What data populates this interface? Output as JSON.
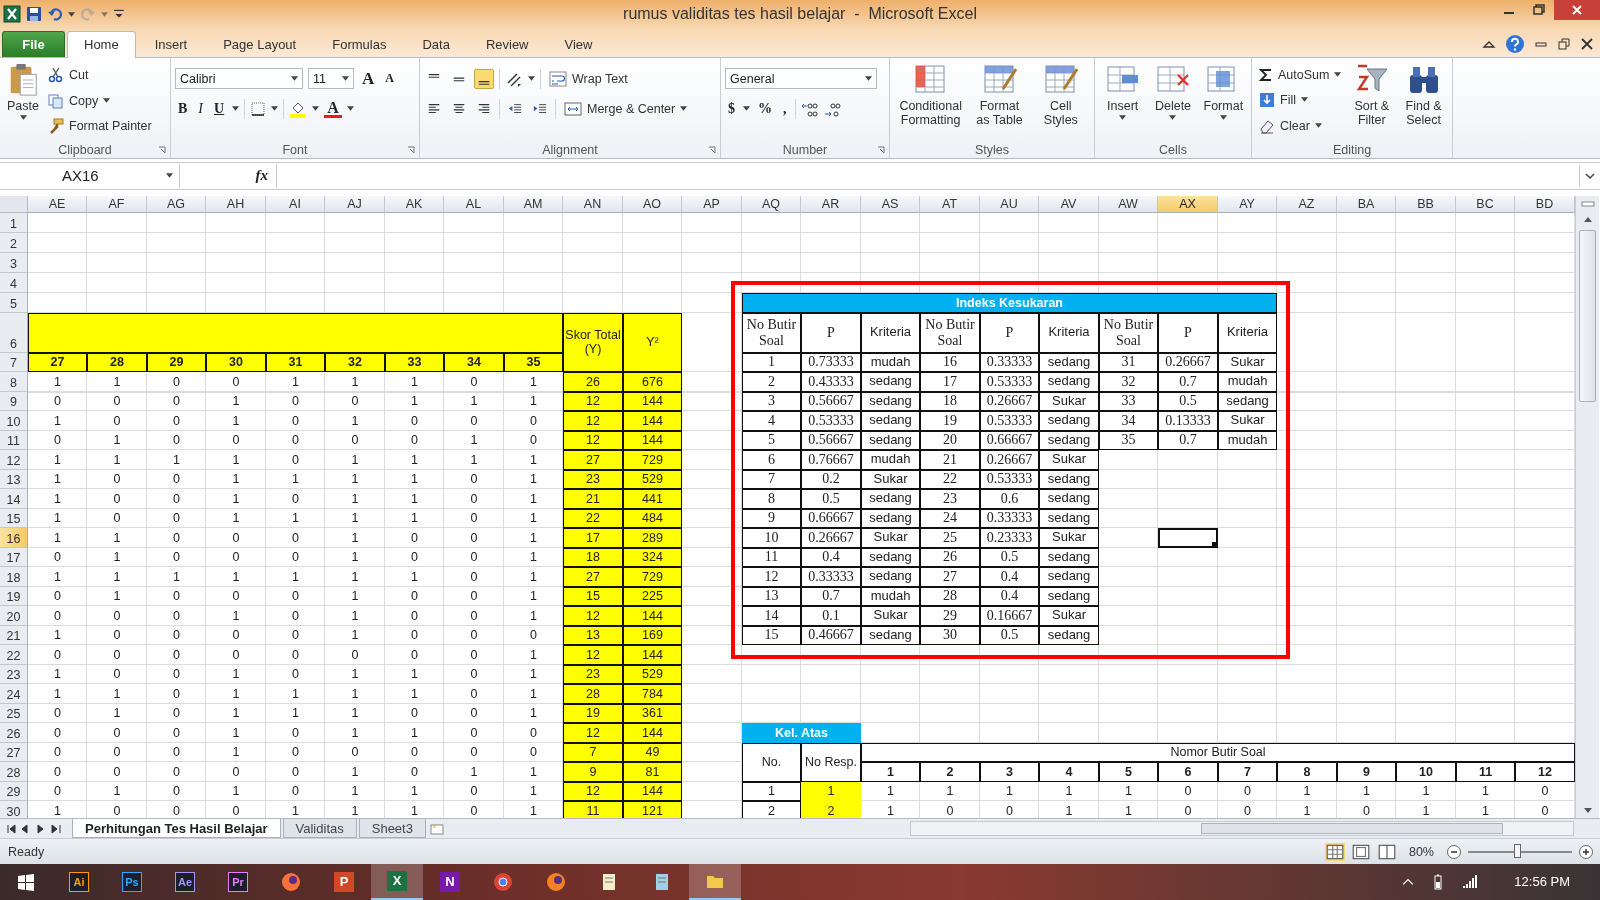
{
  "window": {
    "title": "rumus validitas tes hasil belajar  -  Microsoft Excel"
  },
  "ribbon_tabs": [
    {
      "label": "File",
      "kind": "file",
      "selected": false
    },
    {
      "label": "Home",
      "kind": "tab",
      "selected": true
    },
    {
      "label": "Insert",
      "kind": "tab",
      "selected": false
    },
    {
      "label": "Page Layout",
      "kind": "tab",
      "selected": false
    },
    {
      "label": "Formulas",
      "kind": "tab",
      "selected": false
    },
    {
      "label": "Data",
      "kind": "tab",
      "selected": false
    },
    {
      "label": "Review",
      "kind": "tab",
      "selected": false
    },
    {
      "label": "View",
      "kind": "tab",
      "selected": false
    }
  ],
  "ribbon": {
    "clipboard": {
      "label": "Clipboard",
      "paste": "Paste",
      "cut": "Cut",
      "copy": "Copy",
      "format_painter": "Format Painter"
    },
    "font": {
      "label": "Font",
      "font_name": "Calibri",
      "font_size": "11",
      "grow": "A",
      "shrink": "A",
      "bold": "B",
      "italic": "I",
      "underline": "U",
      "font_color": "A"
    },
    "alignment": {
      "label": "Alignment",
      "valign_buttons": [
        {
          "selected": false
        },
        {
          "selected": false
        },
        {
          "selected": true
        }
      ],
      "wrap_text": "Wrap Text",
      "merge_center": "Merge & Center"
    },
    "number": {
      "label": "Number",
      "format": "General",
      "currency": "$",
      "percent": "%",
      "comma": ","
    },
    "styles": {
      "label": "Styles",
      "buttons": [
        "Conditional Formatting",
        "Format as Table",
        "Cell Styles"
      ]
    },
    "cells": {
      "label": "Cells",
      "buttons": [
        "Insert",
        "Delete",
        "Format"
      ]
    },
    "editing": {
      "label": "Editing",
      "autosum": "AutoSum",
      "fill": "Fill",
      "clear": "Clear",
      "sort_filter": "Sort & Filter",
      "find_select": "Find & Select"
    }
  },
  "formula_bar": {
    "name_box": "AX16",
    "fx": "fx"
  },
  "sheet": {
    "columns": [
      {
        "label": "AE",
        "selected": false
      },
      {
        "label": "AF",
        "selected": false
      },
      {
        "label": "AG",
        "selected": false
      },
      {
        "label": "AH",
        "selected": false
      },
      {
        "label": "AI",
        "selected": false
      },
      {
        "label": "AJ",
        "selected": false
      },
      {
        "label": "AK",
        "selected": false
      },
      {
        "label": "AL",
        "selected": false
      },
      {
        "label": "AM",
        "selected": false
      },
      {
        "label": "AN",
        "selected": false
      },
      {
        "label": "AO",
        "selected": false
      },
      {
        "label": "AP",
        "selected": false
      },
      {
        "label": "AQ",
        "selected": false
      },
      {
        "label": "AR",
        "selected": false
      },
      {
        "label": "AS",
        "selected": false
      },
      {
        "label": "AT",
        "selected": false
      },
      {
        "label": "AU",
        "selected": false
      },
      {
        "label": "AV",
        "selected": false
      },
      {
        "label": "AW",
        "selected": false
      },
      {
        "label": "AX",
        "selected": true
      },
      {
        "label": "AY",
        "selected": false
      },
      {
        "label": "AZ",
        "selected": false
      },
      {
        "label": "BA",
        "selected": false
      },
      {
        "label": "BB",
        "selected": false
      },
      {
        "label": "BC",
        "selected": false
      },
      {
        "label": "BD",
        "selected": false
      }
    ],
    "rows": [
      {
        "label": "1",
        "selected": false
      },
      {
        "label": "2",
        "selected": false
      },
      {
        "label": "3",
        "selected": false
      },
      {
        "label": "4",
        "selected": false
      },
      {
        "label": "5",
        "selected": false
      },
      {
        "label": "6",
        "selected": false
      },
      {
        "label": "7",
        "selected": false
      },
      {
        "label": "8",
        "selected": false
      },
      {
        "label": "9",
        "selected": false
      },
      {
        "label": "10",
        "selected": false
      },
      {
        "label": "11",
        "selected": false
      },
      {
        "label": "12",
        "selected": false
      },
      {
        "label": "13",
        "selected": false
      },
      {
        "label": "14",
        "selected": false
      },
      {
        "label": "15",
        "selected": false
      },
      {
        "label": "16",
        "selected": true
      },
      {
        "label": "17",
        "selected": false
      },
      {
        "label": "18",
        "selected": false
      },
      {
        "label": "19",
        "selected": false
      },
      {
        "label": "20",
        "selected": false
      },
      {
        "label": "21",
        "selected": false
      },
      {
        "label": "22",
        "selected": false
      },
      {
        "label": "23",
        "selected": false
      },
      {
        "label": "24",
        "selected": false
      },
      {
        "label": "25",
        "selected": false
      },
      {
        "label": "26",
        "selected": false
      },
      {
        "label": "27",
        "selected": false
      },
      {
        "label": "28",
        "selected": false
      },
      {
        "label": "29",
        "selected": false
      },
      {
        "label": "30",
        "selected": false
      }
    ]
  },
  "score_table": {
    "item_numbers": [
      "27",
      "28",
      "29",
      "30",
      "31",
      "32",
      "33",
      "34",
      "35"
    ],
    "total_header": "Skor Total (Y)",
    "square_header": "Y²",
    "rows": [
      {
        "scores": [
          "1",
          "1",
          "0",
          "0",
          "1",
          "1",
          "1",
          "0",
          "1"
        ],
        "total": "26",
        "square": "676"
      },
      {
        "scores": [
          "0",
          "0",
          "0",
          "1",
          "0",
          "0",
          "1",
          "1",
          "1"
        ],
        "total": "12",
        "square": "144"
      },
      {
        "scores": [
          "1",
          "0",
          "0",
          "1",
          "0",
          "1",
          "0",
          "0",
          "0"
        ],
        "total": "12",
        "square": "144"
      },
      {
        "scores": [
          "0",
          "1",
          "0",
          "0",
          "0",
          "0",
          "0",
          "1",
          "0"
        ],
        "total": "12",
        "square": "144"
      },
      {
        "scores": [
          "1",
          "1",
          "1",
          "1",
          "0",
          "1",
          "1",
          "1",
          "1"
        ],
        "total": "27",
        "square": "729"
      },
      {
        "scores": [
          "1",
          "0",
          "0",
          "1",
          "1",
          "1",
          "1",
          "0",
          "1"
        ],
        "total": "23",
        "square": "529"
      },
      {
        "scores": [
          "1",
          "0",
          "0",
          "1",
          "0",
          "1",
          "1",
          "0",
          "1"
        ],
        "total": "21",
        "square": "441"
      },
      {
        "scores": [
          "1",
          "0",
          "0",
          "1",
          "1",
          "1",
          "1",
          "0",
          "1"
        ],
        "total": "22",
        "square": "484"
      },
      {
        "scores": [
          "1",
          "1",
          "0",
          "0",
          "0",
          "1",
          "0",
          "0",
          "1"
        ],
        "total": "17",
        "square": "289"
      },
      {
        "scores": [
          "0",
          "1",
          "0",
          "0",
          "0",
          "1",
          "0",
          "0",
          "1"
        ],
        "total": "18",
        "square": "324"
      },
      {
        "scores": [
          "1",
          "1",
          "1",
          "1",
          "1",
          "1",
          "1",
          "0",
          "1"
        ],
        "total": "27",
        "square": "729"
      },
      {
        "scores": [
          "0",
          "1",
          "0",
          "0",
          "0",
          "1",
          "0",
          "0",
          "1"
        ],
        "total": "15",
        "square": "225"
      },
      {
        "scores": [
          "0",
          "0",
          "0",
          "1",
          "0",
          "1",
          "0",
          "0",
          "1"
        ],
        "total": "12",
        "square": "144"
      },
      {
        "scores": [
          "1",
          "0",
          "0",
          "0",
          "0",
          "1",
          "0",
          "0",
          "0"
        ],
        "total": "13",
        "square": "169"
      },
      {
        "scores": [
          "0",
          "0",
          "0",
          "0",
          "0",
          "0",
          "0",
          "0",
          "1"
        ],
        "total": "12",
        "square": "144"
      },
      {
        "scores": [
          "1",
          "0",
          "0",
          "1",
          "0",
          "1",
          "1",
          "0",
          "1"
        ],
        "total": "23",
        "square": "529"
      },
      {
        "scores": [
          "1",
          "1",
          "0",
          "1",
          "1",
          "1",
          "1",
          "0",
          "1"
        ],
        "total": "28",
        "square": "784"
      },
      {
        "scores": [
          "0",
          "1",
          "0",
          "1",
          "1",
          "1",
          "0",
          "0",
          "1"
        ],
        "total": "19",
        "square": "361"
      },
      {
        "scores": [
          "0",
          "0",
          "0",
          "1",
          "0",
          "1",
          "1",
          "0",
          "0"
        ],
        "total": "12",
        "square": "144"
      },
      {
        "scores": [
          "0",
          "0",
          "0",
          "1",
          "0",
          "0",
          "0",
          "0",
          "0"
        ],
        "total": "7",
        "square": "49"
      },
      {
        "scores": [
          "0",
          "0",
          "0",
          "0",
          "0",
          "1",
          "0",
          "1",
          "1"
        ],
        "total": "9",
        "square": "81"
      },
      {
        "scores": [
          "0",
          "1",
          "0",
          "1",
          "0",
          "1",
          "1",
          "0",
          "1"
        ],
        "total": "12",
        "square": "144"
      },
      {
        "scores": [
          "1",
          "0",
          "0",
          "0",
          "1",
          "1",
          "1",
          "0",
          "1"
        ],
        "total": "11",
        "square": "121"
      }
    ]
  },
  "difficulty_table": {
    "title": "Indeks Kesukaran",
    "headers": [
      "No Butir Soal",
      "P",
      "Kriteria",
      "No Butir Soal",
      "P",
      "Kriteria",
      "No Butir Soal",
      "P",
      "Kriteria"
    ],
    "rows": [
      {
        "cells": [
          "1",
          "0.73333",
          "mudah",
          "16",
          "0.33333",
          "sedang",
          "31",
          "0.26667",
          "Sukar"
        ]
      },
      {
        "cells": [
          "2",
          "0.43333",
          "sedang",
          "17",
          "0.53333",
          "sedang",
          "32",
          "0.7",
          "mudah"
        ]
      },
      {
        "cells": [
          "3",
          "0.56667",
          "sedang",
          "18",
          "0.26667",
          "Sukar",
          "33",
          "0.5",
          "sedang"
        ]
      },
      {
        "cells": [
          "4",
          "0.53333",
          "sedang",
          "19",
          "0.53333",
          "sedang",
          "34",
          "0.13333",
          "Sukar"
        ]
      },
      {
        "cells": [
          "5",
          "0.56667",
          "sedang",
          "20",
          "0.66667",
          "sedang",
          "35",
          "0.7",
          "mudah"
        ]
      },
      {
        "cells": [
          "6",
          "0.76667",
          "mudah",
          "21",
          "0.26667",
          "Sukar"
        ]
      },
      {
        "cells": [
          "7",
          "0.2",
          "Sukar",
          "22",
          "0.53333",
          "sedang"
        ]
      },
      {
        "cells": [
          "8",
          "0.5",
          "sedang",
          "23",
          "0.6",
          "sedang"
        ]
      },
      {
        "cells": [
          "9",
          "0.66667",
          "sedang",
          "24",
          "0.33333",
          "sedang"
        ]
      },
      {
        "cells": [
          "10",
          "0.26667",
          "Sukar",
          "25",
          "0.23333",
          "Sukar"
        ]
      },
      {
        "cells": [
          "11",
          "0.4",
          "sedang",
          "26",
          "0.5",
          "sedang"
        ]
      },
      {
        "cells": [
          "12",
          "0.33333",
          "sedang",
          "27",
          "0.4",
          "sedang"
        ]
      },
      {
        "cells": [
          "13",
          "0.7",
          "mudah",
          "28",
          "0.4",
          "sedang"
        ]
      },
      {
        "cells": [
          "14",
          "0.1",
          "Sukar",
          "29",
          "0.16667",
          "Sukar"
        ]
      },
      {
        "cells": [
          "15",
          "0.46667",
          "sedang",
          "30",
          "0.5",
          "sedang"
        ]
      }
    ]
  },
  "upper_group": {
    "title": "Kel. Atas",
    "no_header": "No.",
    "resp_header": "No Resp.",
    "items_header": "Nomor Butir Soal",
    "item_numbers": [
      "1",
      "2",
      "3",
      "4",
      "5",
      "6",
      "7",
      "8",
      "9",
      "10",
      "11",
      "12"
    ],
    "rows": [
      {
        "no": "1",
        "resp": "1",
        "scores": [
          "1",
          "1",
          "1",
          "1",
          "1",
          "0",
          "0",
          "1",
          "1",
          "1",
          "1",
          "0"
        ]
      },
      {
        "no": "2",
        "resp": "2",
        "scores": [
          "1",
          "0",
          "0",
          "1",
          "1",
          "0",
          "0",
          "1",
          "0",
          "1",
          "1",
          "0"
        ]
      }
    ]
  },
  "sheet_tabs": [
    {
      "label": "Perhitungan Tes Hasil Belajar",
      "selected": true
    },
    {
      "label": "Validitas",
      "selected": false
    },
    {
      "label": "Sheet3",
      "selected": false
    }
  ],
  "status_bar": {
    "status": "Ready",
    "zoom": "80%",
    "zoom_slider": {
      "level": 0.47
    }
  },
  "taskbar": {
    "apps": [
      {
        "kind": "outlined",
        "label": "Ai",
        "color": "#ff9a00",
        "selected": false
      },
      {
        "kind": "outlined",
        "label": "Ps",
        "color": "#31a8ff",
        "selected": false
      },
      {
        "kind": "outlined",
        "label": "Ae",
        "color": "#9999ff",
        "selected": false
      },
      {
        "kind": "outlined",
        "label": "Pr",
        "color": "#e77cff",
        "selected": false
      },
      {
        "kind": "globe",
        "color": "#ff7139",
        "selected": false
      },
      {
        "kind": "filled",
        "label": "P",
        "color": "#d24726",
        "selected": false
      },
      {
        "kind": "filled",
        "label": "X",
        "color": "#1e7145",
        "selected": true
      },
      {
        "kind": "filled",
        "label": "N",
        "color": "#7719aa",
        "selected": false
      },
      {
        "kind": "wheel",
        "color": "#db4437",
        "selected": false
      },
      {
        "kind": "globe",
        "color": "#f58220",
        "selected": false
      },
      {
        "kind": "note",
        "color": "#f5f0c8",
        "selected": false
      },
      {
        "kind": "note",
        "color": "#9fd0e8",
        "selected": false
      },
      {
        "kind": "folder",
        "color": "#f2c94c",
        "selected": true
      }
    ],
    "time": "12:56 PM"
  }
}
